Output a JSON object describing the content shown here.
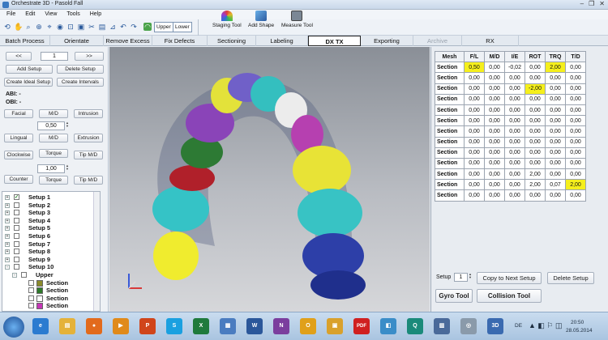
{
  "window": {
    "title": "Orchestrate 3D - Pasold Fall",
    "controls": [
      "–",
      "❐",
      "✕"
    ]
  },
  "menu": [
    "File",
    "Edit",
    "View",
    "Tools",
    "Help"
  ],
  "toolbar": {
    "upper_label": "Upper",
    "lower_label": "Lower",
    "staging_tool": "Staging Tool",
    "add_shape": "Add Shape",
    "measure_tool": "Measure Tool",
    "icons": [
      "rotate-icon",
      "pan-icon",
      "zoom-icon",
      "zoom-window-icon",
      "select-icon",
      "view-icon",
      "fit-icon",
      "camera-icon",
      "cut-icon",
      "ruler-icon",
      "arch-icon"
    ]
  },
  "tabs": [
    {
      "label": "Batch Process",
      "state": "normal"
    },
    {
      "label": "Orientate",
      "state": "normal"
    },
    {
      "label": "Remove Excess",
      "state": "normal"
    },
    {
      "label": "Fix Defects",
      "state": "normal"
    },
    {
      "label": "Sectioning",
      "state": "normal"
    },
    {
      "label": "Labeling",
      "state": "normal"
    },
    {
      "label": "DX TX",
      "state": "active"
    },
    {
      "label": "Exporting",
      "state": "normal"
    },
    {
      "label": "Archive",
      "state": "disabled"
    },
    {
      "label": "RX",
      "state": "normal"
    }
  ],
  "left": {
    "prev": "<<",
    "next": ">>",
    "setup_number": "1",
    "add_setup": "Add Setup",
    "delete_setup": "Delete Setup",
    "create_ideal": "Create Ideal Setup",
    "create_intervals": "Create Intervals",
    "abi": "ABI: -",
    "obi": "OBI: -",
    "facial": "Facial",
    "md1": "M/D",
    "intrusion": "Intrusion",
    "step1": "0,50",
    "lingual": "Lingual",
    "md2": "M/D",
    "extrusion": "Extrusion",
    "clockwise": "Clockwise",
    "torque1": "Torque",
    "tip1": "Tip M/D",
    "step2": "1,00",
    "counter": "Counter",
    "torque2": "Torque",
    "tip2": "Tip M/D",
    "tree": [
      {
        "label": "Setup 1",
        "checked": true,
        "level": 0,
        "expander": "+"
      },
      {
        "label": "Setup 2",
        "checked": false,
        "level": 0,
        "expander": "+"
      },
      {
        "label": "Setup 3",
        "checked": false,
        "level": 0,
        "expander": "+"
      },
      {
        "label": "Setup 4",
        "checked": false,
        "level": 0,
        "expander": "+"
      },
      {
        "label": "Setup 5",
        "checked": false,
        "level": 0,
        "expander": "+"
      },
      {
        "label": "Setup 6",
        "checked": false,
        "level": 0,
        "expander": "+"
      },
      {
        "label": "Setup 7",
        "checked": false,
        "level": 0,
        "expander": "+"
      },
      {
        "label": "Setup 8",
        "checked": false,
        "level": 0,
        "expander": "+"
      },
      {
        "label": "Setup 9",
        "checked": false,
        "level": 0,
        "expander": "+"
      },
      {
        "label": "Setup 10",
        "checked": false,
        "level": 0,
        "expander": "-"
      },
      {
        "label": "Upper",
        "checked": false,
        "level": 1,
        "expander": "-"
      },
      {
        "label": "Section",
        "checked": false,
        "level": 2,
        "swatch": "#8b8a2a"
      },
      {
        "label": "Section",
        "checked": false,
        "level": 2,
        "swatch": "#2e7a2a"
      },
      {
        "label": "Section",
        "checked": false,
        "level": 2,
        "swatch": "#ffffff"
      },
      {
        "label": "Section",
        "checked": false,
        "level": 2,
        "swatch": "#c437b6"
      }
    ]
  },
  "table": {
    "headers": [
      "Mesh",
      "F/L",
      "M/D",
      "I/E",
      "ROT",
      "TRQ",
      "T/D"
    ],
    "rows": [
      {
        "cells": [
          "Section",
          "0,50",
          "0,00",
          "-0,02",
          "0,00",
          "2,00",
          "0,00"
        ],
        "hl": [
          1,
          5
        ]
      },
      {
        "cells": [
          "Section",
          "0,00",
          "0,00",
          "0,00",
          "0,00",
          "0,00",
          "0,00"
        ],
        "hl": []
      },
      {
        "cells": [
          "Section",
          "0,00",
          "0,00",
          "0,00",
          "-2,00",
          "0,00",
          "0,00"
        ],
        "hl": [
          4
        ]
      },
      {
        "cells": [
          "Section",
          "0,00",
          "0,00",
          "0,00",
          "0,00",
          "0,00",
          "0,00"
        ],
        "hl": []
      },
      {
        "cells": [
          "Section",
          "0,00",
          "0,00",
          "0,00",
          "0,00",
          "0,00",
          "0,00"
        ],
        "hl": []
      },
      {
        "cells": [
          "Section",
          "0,00",
          "0,00",
          "0,00",
          "0,00",
          "0,00",
          "0,00"
        ],
        "hl": []
      },
      {
        "cells": [
          "Section",
          "0,00",
          "0,00",
          "0,00",
          "0,00",
          "0,00",
          "0,00"
        ],
        "hl": []
      },
      {
        "cells": [
          "Section",
          "0,00",
          "0,00",
          "0,00",
          "0,00",
          "0,00",
          "0,00"
        ],
        "hl": []
      },
      {
        "cells": [
          "Section",
          "0,00",
          "0,00",
          "0,00",
          "0,00",
          "0,00",
          "0,00"
        ],
        "hl": []
      },
      {
        "cells": [
          "Section",
          "0,00",
          "0,00",
          "0,00",
          "0,00",
          "0,00",
          "0,00"
        ],
        "hl": []
      },
      {
        "cells": [
          "Section",
          "0,00",
          "0,00",
          "0,00",
          "2,00",
          "0,00",
          "0,00"
        ],
        "hl": []
      },
      {
        "cells": [
          "Section",
          "0,00",
          "0,00",
          "0,00",
          "2,00",
          "0,07",
          "2,00"
        ],
        "hl": [
          6
        ]
      },
      {
        "cells": [
          "Section",
          "0,00",
          "0,00",
          "0,00",
          "0,00",
          "0,00",
          "0,00"
        ],
        "hl": []
      }
    ],
    "highlight_color": "#f5ef1c"
  },
  "right_controls": {
    "setup_label": "Setup",
    "setup_value": "1",
    "copy_next": "Copy to Next Setup",
    "delete_setup": "Delete Setup",
    "gyro_tool": "Gyro Tool",
    "collision_tool": "Collision Tool"
  },
  "taskbar": {
    "apps": [
      {
        "name": "ie-icon",
        "color": "#2b7bd0",
        "glyph": "e"
      },
      {
        "name": "folder-icon",
        "color": "#e4b23a",
        "glyph": "▤"
      },
      {
        "name": "firefox-icon",
        "color": "#e26a1c",
        "glyph": "●"
      },
      {
        "name": "media-player-icon",
        "color": "#e08a1a",
        "glyph": "▶"
      },
      {
        "name": "powerpoint-icon",
        "color": "#d0451b",
        "glyph": "P"
      },
      {
        "name": "skype-icon",
        "color": "#1aa0e0",
        "glyph": "S"
      },
      {
        "name": "excel-icon",
        "color": "#1f7a3c",
        "glyph": "X"
      },
      {
        "name": "explorer-icon",
        "color": "#4a7cc0",
        "glyph": "▦"
      },
      {
        "name": "word-icon",
        "color": "#2b579a",
        "glyph": "W"
      },
      {
        "name": "onenote-icon",
        "color": "#7b3e9e",
        "glyph": "N"
      },
      {
        "name": "outlook-icon",
        "color": "#e0a01a",
        "glyph": "O"
      },
      {
        "name": "notes-icon",
        "color": "#d9a12c",
        "glyph": "▣"
      },
      {
        "name": "pdf-icon",
        "color": "#d02020",
        "glyph": "PDF"
      },
      {
        "name": "app-icon",
        "color": "#3a8dc8",
        "glyph": "◧"
      },
      {
        "name": "q-icon",
        "color": "#1a8a7a",
        "glyph": "Q"
      },
      {
        "name": "tool-icon",
        "color": "#4a6a9a",
        "glyph": "▥"
      },
      {
        "name": "drive-icon",
        "color": "#8a9aaa",
        "glyph": "◎"
      },
      {
        "name": "orchestrate-icon",
        "color": "#3a6ab0",
        "glyph": "3D"
      }
    ],
    "lang": "DE",
    "time": "20:50",
    "date": "28.05.2014"
  }
}
